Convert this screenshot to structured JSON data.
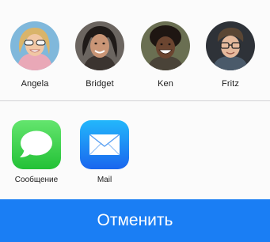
{
  "contacts": [
    {
      "name": "Angela",
      "avatar_icon": "person-avatar-icon",
      "bg": "#7fb6d8"
    },
    {
      "name": "Bridget",
      "avatar_icon": "person-avatar-icon",
      "bg": "#6b6560"
    },
    {
      "name": "Ken",
      "avatar_icon": "person-avatar-icon",
      "bg": "#6a6f52"
    },
    {
      "name": "Fritz",
      "avatar_icon": "person-avatar-icon",
      "bg": "#2e3238"
    }
  ],
  "apps": [
    {
      "name": "Сообщение",
      "icon": "messages-app-icon",
      "color": "#41d34d"
    },
    {
      "name": "Mail",
      "icon": "mail-app-icon",
      "color": "#1e78f0"
    }
  ],
  "cancel_label": "Отменить",
  "colors": {
    "accent": "#1a7ef4",
    "messages_green": "#41d34d",
    "mail_blue": "#1e78f0"
  }
}
